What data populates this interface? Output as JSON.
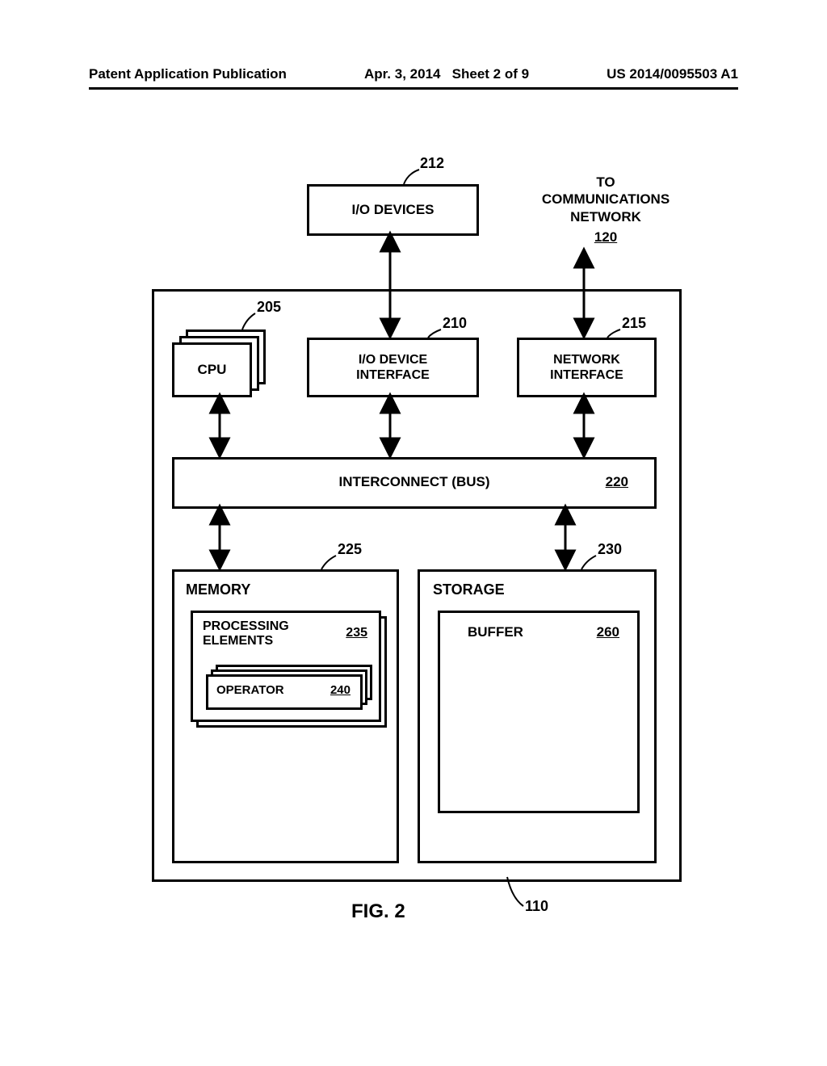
{
  "header": {
    "pub": "Patent Application Publication",
    "date": "Apr. 3, 2014",
    "sheet": "Sheet 2 of 9",
    "docnum": "US 2014/0095503 A1"
  },
  "top": {
    "io_devices": "I/O DEVICES",
    "comm1": "TO",
    "comm2": "COMMUNICATIONS",
    "comm3": "NETWORK",
    "comm_ref": "120"
  },
  "row": {
    "cpu": "CPU",
    "io_if": "I/O DEVICE\nINTERFACE",
    "net_if": "NETWORK\nINTERFACE"
  },
  "bus": {
    "label": "INTERCONNECT (BUS)",
    "ref": "220"
  },
  "mem": {
    "title": "MEMORY",
    "pe": "PROCESSING\nELEMENTS",
    "pe_ref": "235",
    "op": "OPERATOR",
    "op_ref": "240"
  },
  "stor": {
    "title": "STORAGE",
    "buf": "BUFFER",
    "buf_ref": "260"
  },
  "refs": {
    "r212": "212",
    "r205": "205",
    "r210": "210",
    "r215": "215",
    "r225": "225",
    "r230": "230",
    "r110": "110"
  },
  "figure": "FIG. 2"
}
